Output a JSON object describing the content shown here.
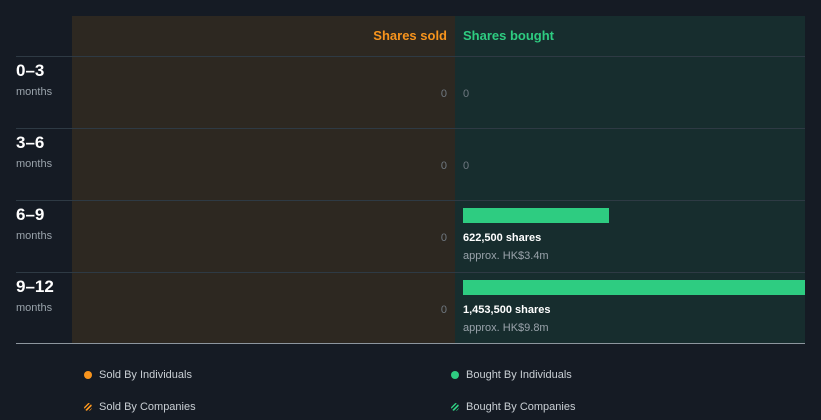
{
  "chart_data": {
    "type": "bar",
    "orientation": "horizontal",
    "columns": {
      "sold": "Shares sold",
      "bought": "Shares bought"
    },
    "categories": [
      {
        "period": "0–3",
        "unit": "months"
      },
      {
        "period": "3–6",
        "unit": "months"
      },
      {
        "period": "6–9",
        "unit": "months"
      },
      {
        "period": "9–12",
        "unit": "months"
      }
    ],
    "sold_values": [
      0,
      0,
      0,
      0
    ],
    "sold_labels": [
      "0",
      "0",
      "0",
      "0"
    ],
    "bought_values": [
      0,
      0,
      622500,
      1453500
    ],
    "bought_labels": [
      "0",
      "0",
      "622,500 shares",
      "1,453,500 shares"
    ],
    "bought_approx": [
      "",
      "",
      "approx. HK$3.4m",
      "approx. HK$9.8m"
    ],
    "xlim": [
      0,
      1453500
    ]
  },
  "legend": [
    {
      "label": "Sold By Individuals",
      "color": "#f7941d",
      "style": "solid"
    },
    {
      "label": "Bought By Individuals",
      "color": "#2ecc81",
      "style": "solid"
    },
    {
      "label": "Sold By Companies",
      "color": "#f7941d",
      "style": "hatched"
    },
    {
      "label": "Bought By Companies",
      "color": "#2ecc81",
      "style": "hatched"
    }
  ],
  "colors": {
    "sold": "#f7941d",
    "bought": "#2ecc81"
  }
}
